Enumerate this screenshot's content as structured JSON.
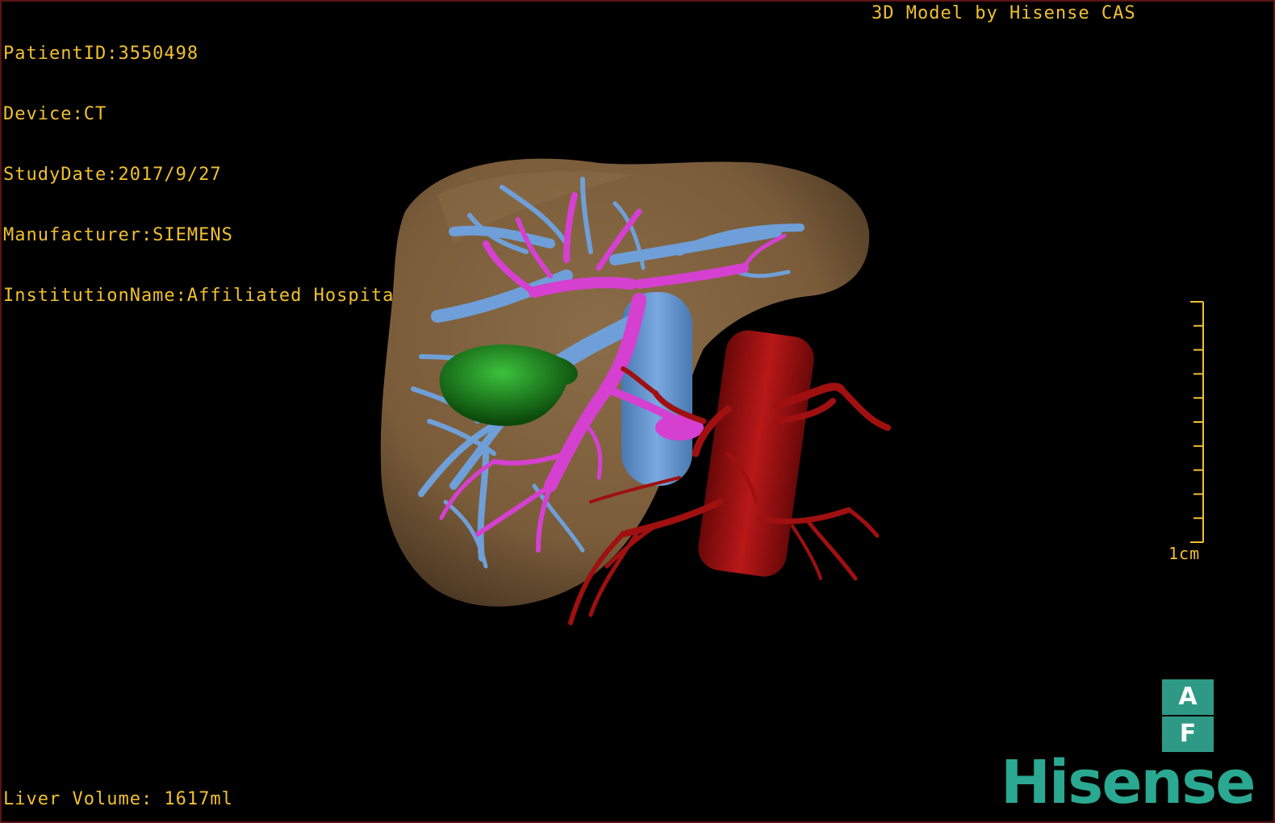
{
  "overlay": {
    "patient_id": "PatientID:3550498",
    "device": "Device:CT",
    "study_date": "StudyDate:2017/9/27",
    "manufacturer": "Manufacturer:SIEMENS",
    "institution": "InstitutionName:Affiliated Hospital Qingdao University-C",
    "credit": "3D Model by Hisense CAS",
    "liver_volume": "Liver Volume: 1617ml"
  },
  "scale_bar": {
    "label": "1cm",
    "tick_count": 10
  },
  "orientation_cube": {
    "top": "A",
    "bottom": "F"
  },
  "logo_text": "Hisense",
  "colors": {
    "overlay_text": "#f0c030",
    "liver": "#7a5c3a",
    "portal_vein": "#6f9fd8",
    "hepatic_vein": "#d640d0",
    "artery": "#a01010",
    "tumor": "#1e7a1e",
    "brand": "#2aa891"
  }
}
